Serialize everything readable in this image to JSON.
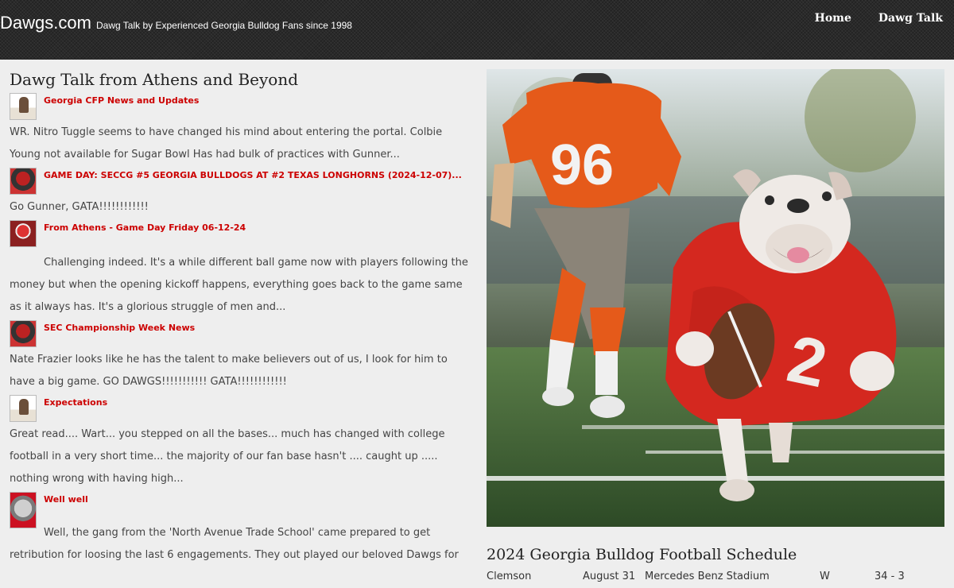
{
  "header": {
    "brand": "Dawgs.com",
    "tagline": "Dawg Talk by Experienced Georgia Bulldog Fans since 1998",
    "nav": [
      {
        "label": "Home"
      },
      {
        "label": "Dawg Talk"
      }
    ]
  },
  "main": {
    "title": "Dawg Talk from Athens and Beyond",
    "posts": [
      {
        "title": "Georgia CFP News and Updates",
        "excerpt": "WR. Nitro Tuggle seems to have changed his mind about entering the portal. Colbie Young not available for Sugar Bowl Has had bulk of practices with Gunner...",
        "thumb": "avatar-icon"
      },
      {
        "title": "GAME DAY: SECCG #5 GEORGIA BULLDOGS AT #2 TEXAS LONGHORNS (2024-12-07)...",
        "excerpt": "Go Gunner, GATA!!!!!!!!!!!!",
        "thumb": "avatar-icon"
      },
      {
        "title": "From Athens - Game Day Friday 06-12-24",
        "excerpt": "Challenging indeed. It's a while different ball game now with players following the money but when the opening kickoff happens, everything goes back to the game same as it always has. It's a glorious struggle of men and...",
        "thumb": "avatar-icon"
      },
      {
        "title": "SEC Championship Week News",
        "excerpt": "Nate Frazier looks like he has the talent to make believers out of us, I look for him to have a big game. GO DAWGS!!!!!!!!!!!  GATA!!!!!!!!!!!!",
        "thumb": "avatar-icon"
      },
      {
        "title": "Expectations",
        "excerpt": "Great read.... Wart... you stepped on all the bases... much has changed with college football in a very short time... the majority of our fan base hasn't .... caught up ..... nothing wrong with having high...",
        "thumb": "avatar-icon"
      },
      {
        "title": "Well well",
        "excerpt": "Well, the gang from the 'North Avenue Trade School' came prepared to get retribution for loosing the last 6 engagements. They out played our beloved Dawgs for",
        "thumb": "bulldog-avatar-icon"
      }
    ]
  },
  "hero": {
    "icon": "bulldog-football-image",
    "player_number": "96",
    "jersey_number": "2"
  },
  "schedule": {
    "title": "2024 Georgia Bulldog Football Schedule",
    "rows": [
      {
        "opponent": "Clemson",
        "date": "August 31",
        "venue": "Mercedes Benz Stadium",
        "result": "W",
        "score": "34 - 3"
      }
    ]
  }
}
